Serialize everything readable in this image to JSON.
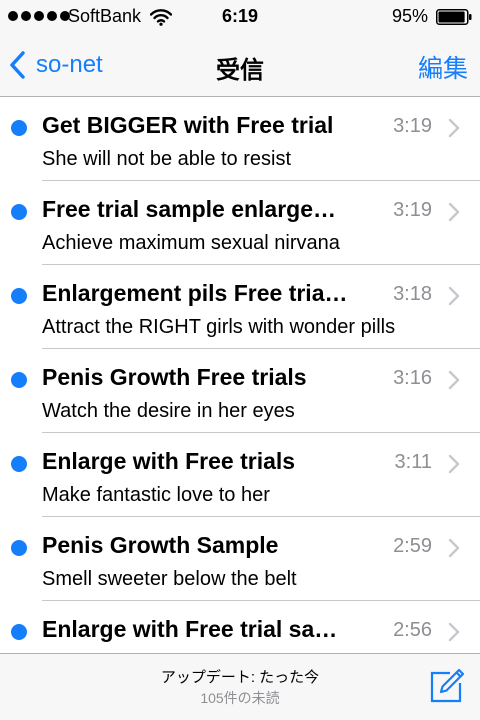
{
  "status_bar": {
    "carrier": "SoftBank",
    "time": "6:19",
    "battery_percent": "95%",
    "battery_level": 0.95,
    "signal_bars": 5,
    "wifi_icon": "wifi-icon",
    "battery_icon": "battery-icon"
  },
  "nav": {
    "back_label": "so-net",
    "back_icon": "chevron-left-icon",
    "title": "受信",
    "edit_label": "編集"
  },
  "colors": {
    "accent": "#157efb",
    "unread_dot": "#157efb",
    "secondary_text": "#8e8e93",
    "bar_background": "#f7f7f7"
  },
  "messages": [
    {
      "sender": "Get BIGGER with Free trial",
      "time": "3:19",
      "subject": "She will not be able to resist",
      "unread": true
    },
    {
      "sender": "Free trial sample enlarge…",
      "time": "3:19",
      "subject": "Achieve maximum sexual nirvana",
      "unread": true
    },
    {
      "sender": "Enlargement pils Free tria…",
      "time": "3:18",
      "subject": "Attract the RIGHT girls with wonder pills",
      "unread": true
    },
    {
      "sender": "Penis Growth Free trials",
      "time": "3:16",
      "subject": "Watch the desire in her eyes",
      "unread": true
    },
    {
      "sender": "Enlarge with Free trials",
      "time": "3:11",
      "subject": "Make fantastic love to her",
      "unread": true
    },
    {
      "sender": "Penis Growth Sample",
      "time": "2:59",
      "subject": "Smell sweeter below the belt",
      "unread": true
    },
    {
      "sender": "Enlarge with Free trial sa…",
      "time": "2:56",
      "subject": "",
      "unread": true
    }
  ],
  "toolbar": {
    "update_status": "アップデート: たった今",
    "unread_count": "105件の未読",
    "compose_icon": "compose-icon"
  }
}
